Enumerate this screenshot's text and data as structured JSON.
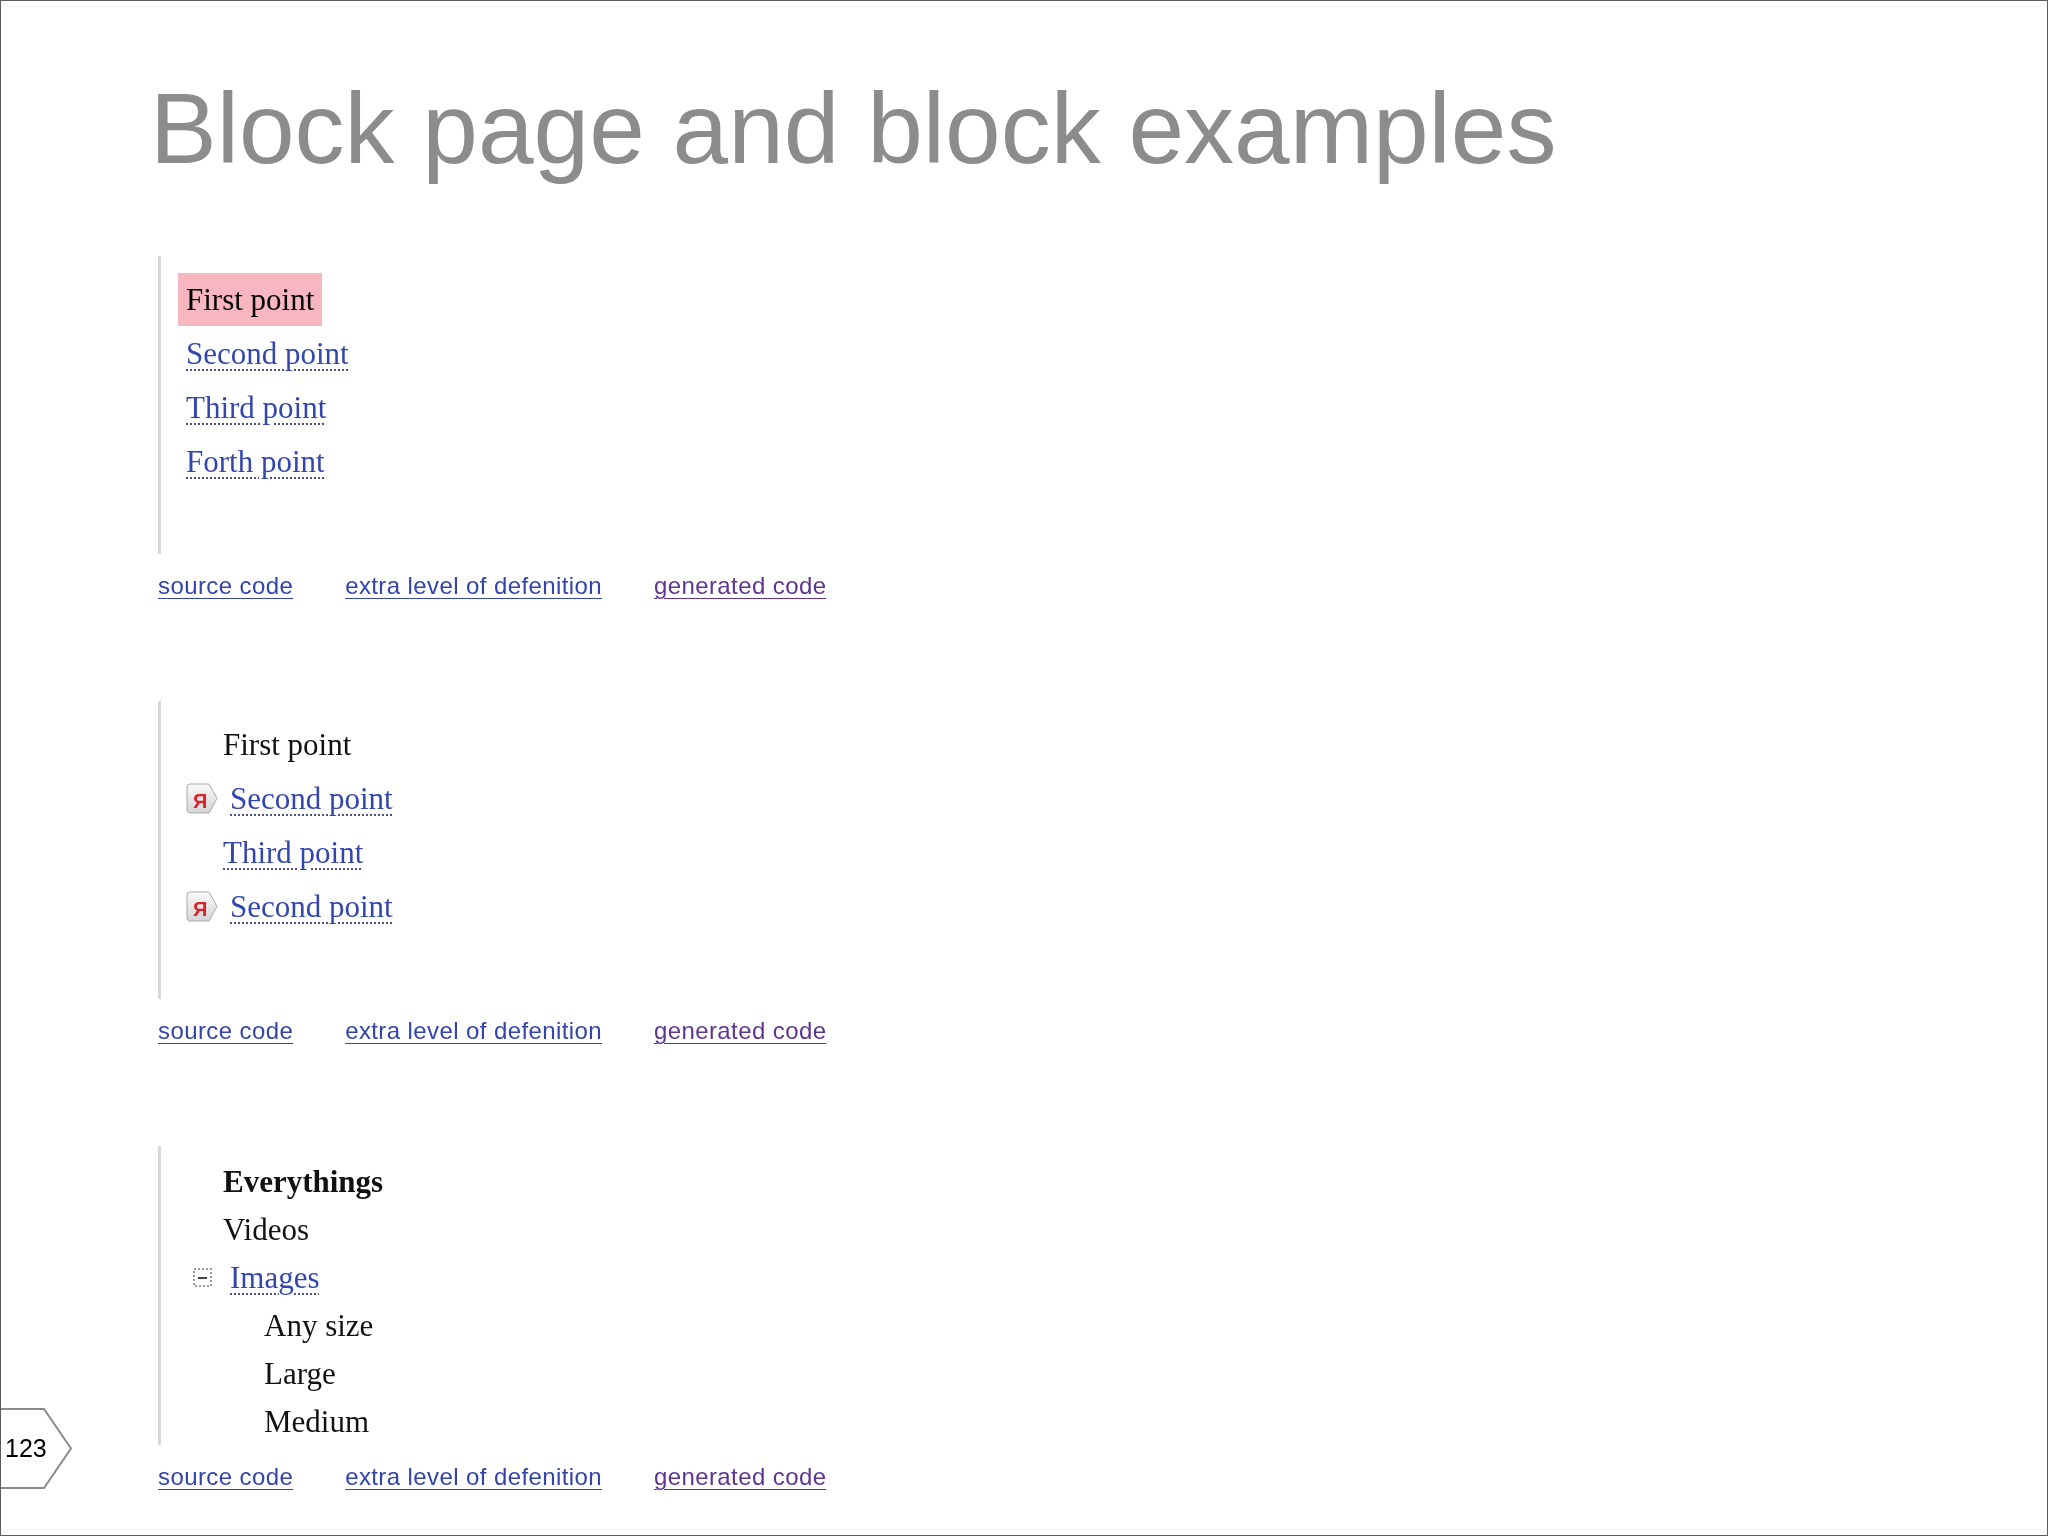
{
  "slide": {
    "title": "Block page and block examples",
    "page_number": "123"
  },
  "examples": [
    {
      "items": [
        {
          "label": "First point",
          "kind": "highlighted"
        },
        {
          "label": "Second point",
          "kind": "link"
        },
        {
          "label": "Third point",
          "kind": "link"
        },
        {
          "label": "Forth point",
          "kind": "link"
        }
      ],
      "links": [
        {
          "label": "source code",
          "visited": false
        },
        {
          "label": "extra level of defenition",
          "visited": false
        },
        {
          "label": "generated code",
          "visited": true
        }
      ]
    },
    {
      "items": [
        {
          "label": "First point",
          "kind": "plain"
        },
        {
          "label": "Second point",
          "kind": "link",
          "marker": "Я"
        },
        {
          "label": "Third point",
          "kind": "link"
        },
        {
          "label": "Second point",
          "kind": "link",
          "marker": "Я"
        }
      ],
      "links": [
        {
          "label": "source code",
          "visited": false
        },
        {
          "label": "extra level of defenition",
          "visited": false
        },
        {
          "label": "generated code",
          "visited": true
        }
      ]
    },
    {
      "items": [
        {
          "label": "Everythings",
          "kind": "bold"
        },
        {
          "label": "Videos",
          "kind": "plain"
        },
        {
          "label": "Images",
          "kind": "link",
          "expanded": true,
          "children": [
            {
              "label": "Any size",
              "kind": "plain"
            },
            {
              "label": "Large",
              "kind": "plain"
            },
            {
              "label": "Medium",
              "kind": "plain"
            }
          ]
        }
      ],
      "links": [
        {
          "label": "source code",
          "visited": false
        },
        {
          "label": "extra level of defenition",
          "visited": false
        },
        {
          "label": "generated code",
          "visited": true
        }
      ]
    }
  ]
}
